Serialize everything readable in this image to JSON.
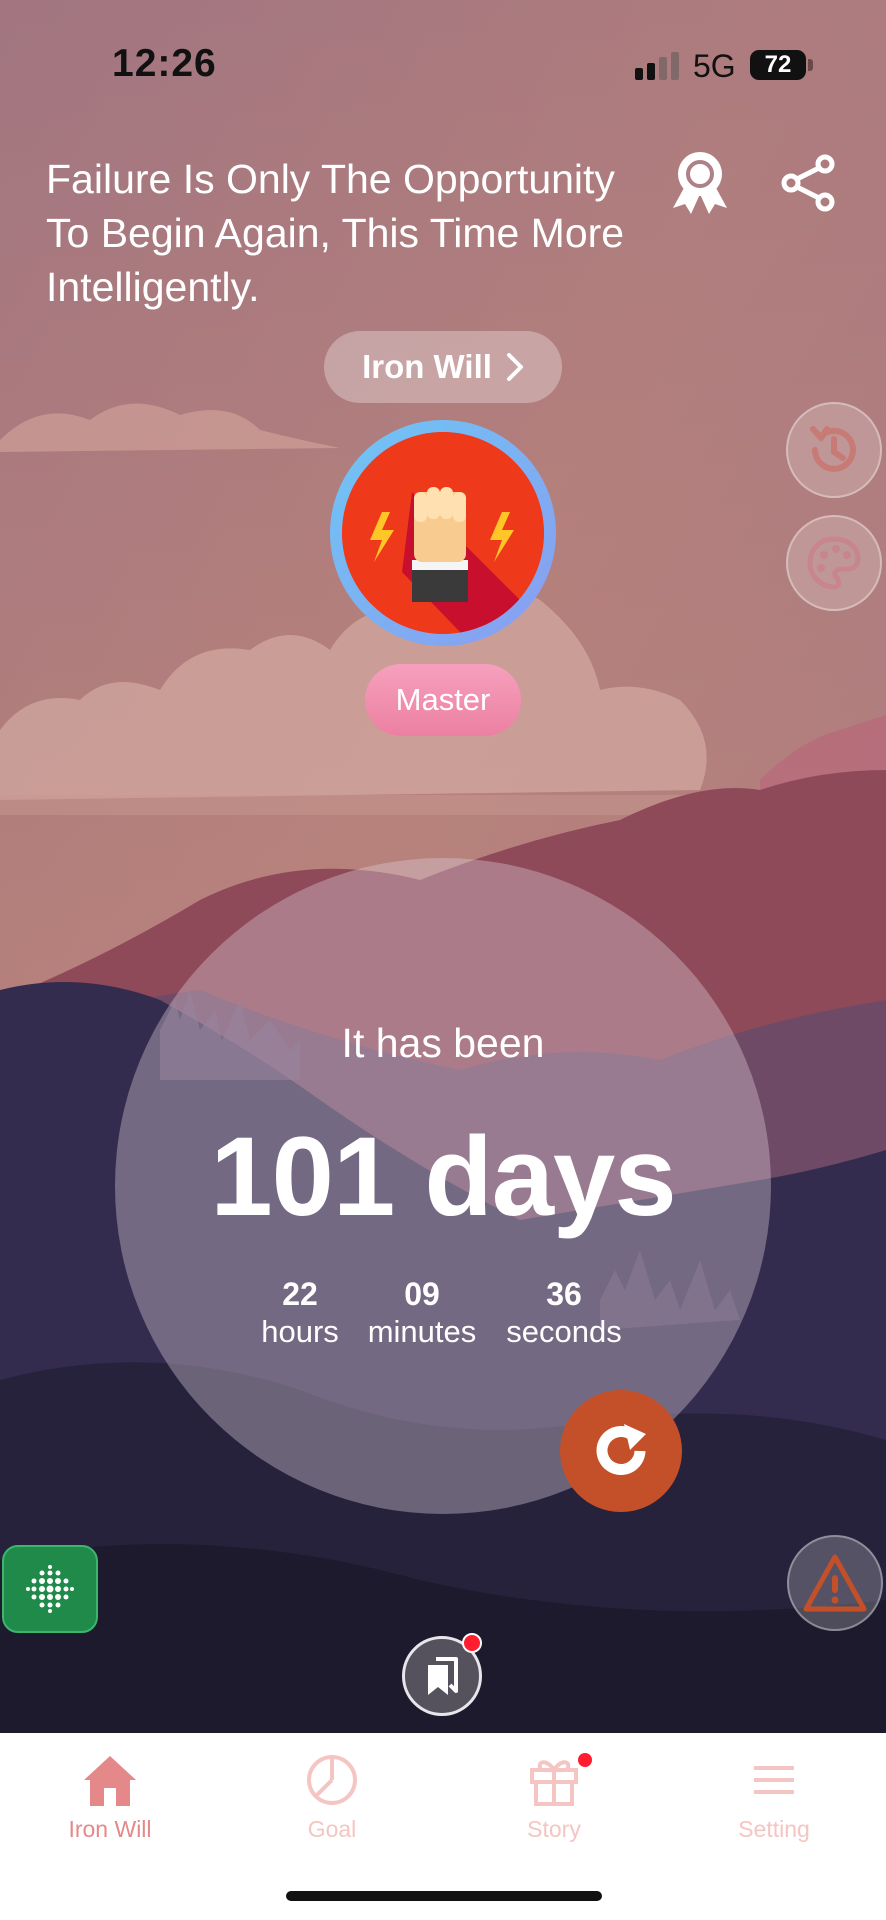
{
  "status_bar": {
    "time": "12:26",
    "network": "5G",
    "battery": "72"
  },
  "quote": "Failure Is Only The Opportunity To Begin Again, This Time More Intelligently.",
  "habit": {
    "name": "Iron Will",
    "level": "Master"
  },
  "timer": {
    "intro": "It has been",
    "days": "101 days",
    "hours_value": "22",
    "hours_label": "hours",
    "minutes_value": "09",
    "minutes_label": "minutes",
    "seconds_value": "36",
    "seconds_label": "seconds"
  },
  "icons": {
    "award": "award-ribbon-icon",
    "share": "share-icon",
    "history": "history-icon",
    "theme": "palette-icon",
    "reset": "reset-icon",
    "warning": "warning-icon",
    "breathing": "dot-grid-icon",
    "bookmark": "bookmark-icon"
  },
  "tabs": [
    {
      "label": "Iron Will",
      "icon": "home-icon",
      "active": true
    },
    {
      "label": "Goal",
      "icon": "pie-chart-icon",
      "active": false
    },
    {
      "label": "Story",
      "icon": "gift-icon",
      "active": false
    },
    {
      "label": "Setting",
      "icon": "menu-icon",
      "active": false
    }
  ],
  "colors": {
    "active_tab": "#e5888a",
    "inactive_tab": "#f4c5c2",
    "accent_reset": "#c4502a",
    "badge_pink": "#ec80a2"
  }
}
